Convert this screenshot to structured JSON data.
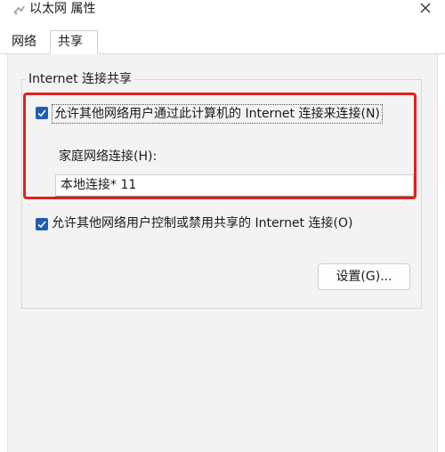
{
  "window": {
    "title": "以太网 属性"
  },
  "tabs": [
    {
      "label": "网络",
      "selected": false
    },
    {
      "label": "共享",
      "selected": true
    }
  ],
  "sharing": {
    "group_title": "Internet 连接共享",
    "allow_sharing": {
      "label": "允许其他网络用户通过此计算机的 Internet 连接来连接(N)",
      "checked": true
    },
    "home_network_label": "家庭网络连接(H):",
    "home_network_value": "本地连接* 11",
    "allow_control": {
      "label": "允许其他网络用户控制或禁用共享的 Internet 连接(O)",
      "checked": true
    },
    "settings_button": "设置(G)..."
  },
  "colors": {
    "checkbox": "#1e5fb4",
    "highlight_frame": "#e0201b",
    "panel": "#f3f3f3"
  }
}
